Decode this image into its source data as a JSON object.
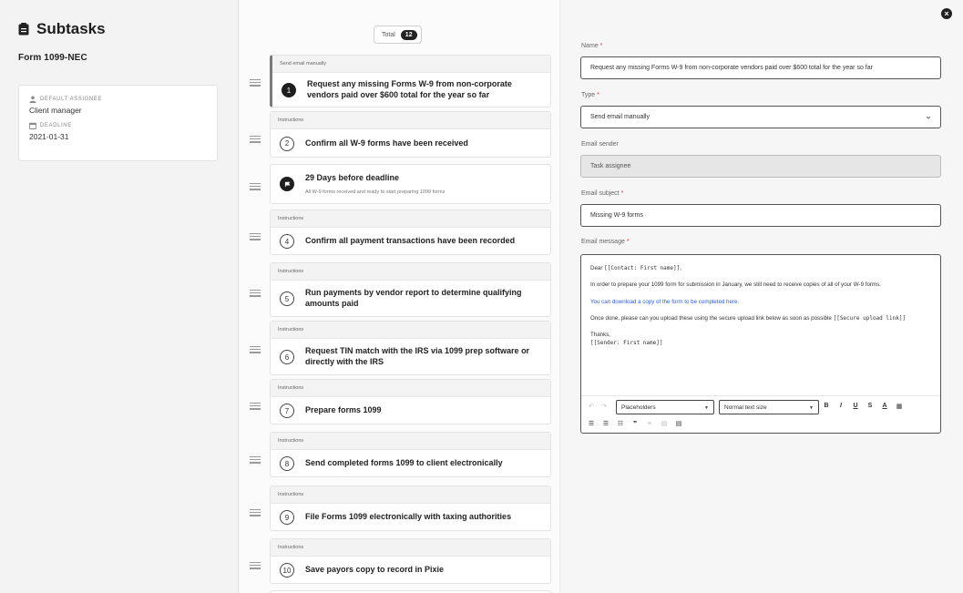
{
  "sidebar": {
    "title": "Subtasks",
    "form_name": "Form 1099-NEC",
    "default_assignee_label": "DEFAULT ASSIGNEE",
    "default_assignee_value": "Client manager",
    "deadline_label": "DEADLINE",
    "deadline_value": "2021-01-31"
  },
  "list": {
    "total_label": "Total",
    "total_count": "12",
    "tasks": [
      {
        "header": "Send email manually",
        "number": "1",
        "text": "Request any missing Forms W-9 from non-corporate vendors paid over $600 total for the year so far"
      },
      {
        "header": "Instructions",
        "number": "2",
        "text": "Confirm all W-9 forms have been received"
      },
      {
        "header": "",
        "number": "",
        "text": "29 Days before deadline",
        "sub": "All W-9 forms received and ready to start preparing 1099 forms"
      },
      {
        "header": "Instructions",
        "number": "4",
        "text": "Confirm all payment transactions have been recorded"
      },
      {
        "header": "Instructions",
        "number": "5",
        "text": "Run payments by vendor report to determine qualifying amounts paid"
      },
      {
        "header": "Instructions",
        "number": "6",
        "text": "Request TIN match with the IRS via 1099 prep software or directly with the IRS"
      },
      {
        "header": "Instructions",
        "number": "7",
        "text": "Prepare forms 1099"
      },
      {
        "header": "Instructions",
        "number": "8",
        "text": "Send completed forms 1099 to client electronically"
      },
      {
        "header": "Instructions",
        "number": "9",
        "text": "File Forms 1099 electronically with taxing authorities"
      },
      {
        "header": "Instructions",
        "number": "10",
        "text": "Save payors copy to record in Pixie"
      }
    ]
  },
  "detail": {
    "name_label": "Name",
    "name_value": "Request any missing Forms W-9 from non-corporate vendors paid over $600 total for the year so far",
    "type_label": "Type",
    "type_value": "Send email manually",
    "sender_label": "Email sender",
    "sender_value": "Task assignee",
    "subject_label": "Email subject",
    "subject_value": "Missing W-9 forms",
    "message_label": "Email message",
    "message": {
      "greeting": "Dear ",
      "greeting_tag": "[[Contact: First name]]",
      "greeting_end": ",",
      "p1": "In order to prepare your 1099 form for submission in January, we still need to receive copies of all of your W-9 forms.",
      "link": "You can download a copy of the form to be completed here.",
      "p3": "Once done, please can you upload these using the secure upload link below as soon as possible ",
      "p3_tag": "[[Secure upload link]]",
      "thanks": "Thanks,",
      "sender_tag": "[[Sender: First name]]"
    },
    "toolbar": {
      "placeholders": "Placeholders",
      "text_size": "Normal text size"
    },
    "required_mark": "*"
  },
  "colors": {
    "link": "#2a5fd6",
    "required": "#dd3333",
    "badge": "#222222"
  }
}
